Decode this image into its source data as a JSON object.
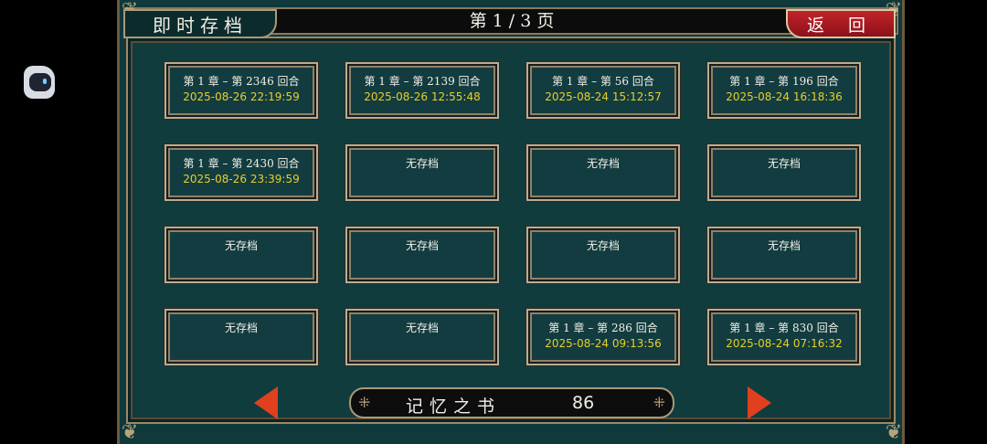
{
  "header": {
    "title": "即时存档",
    "page_indicator": "第 1 / 3 页",
    "back_label": "返 回"
  },
  "slots": [
    {
      "line1": "第 1 章 – 第 2346 回合",
      "line2": "2025-08-26 22:19:59"
    },
    {
      "line1": "第 1 章 – 第 2139 回合",
      "line2": "2025-08-26 12:55:48"
    },
    {
      "line1": "第 1 章 – 第 56 回合",
      "line2": "2025-08-24 15:12:57"
    },
    {
      "line1": "第 1 章 – 第 196 回合",
      "line2": "2025-08-24 16:18:36"
    },
    {
      "line1": "第 1 章 – 第 2430 回合",
      "line2": "2025-08-26 23:39:59"
    },
    {
      "line1": "无存档",
      "line2": ""
    },
    {
      "line1": "无存档",
      "line2": ""
    },
    {
      "line1": "无存档",
      "line2": ""
    },
    {
      "line1": "无存档",
      "line2": ""
    },
    {
      "line1": "无存档",
      "line2": ""
    },
    {
      "line1": "无存档",
      "line2": ""
    },
    {
      "line1": "无存档",
      "line2": ""
    },
    {
      "line1": "无存档",
      "line2": ""
    },
    {
      "line1": "无存档",
      "line2": ""
    },
    {
      "line1": "第 1 章 – 第 286 回合",
      "line2": "2025-08-24 09:13:56"
    },
    {
      "line1": "第 1 章 – 第 830 回合",
      "line2": "2025-08-24 07:16:32"
    }
  ],
  "footer": {
    "book_label": "记忆之书",
    "book_count": "86"
  },
  "colors": {
    "accent_red": "#c2232b",
    "timestamp_yellow": "#e9cf2a",
    "panel_teal": "#123c3f"
  }
}
